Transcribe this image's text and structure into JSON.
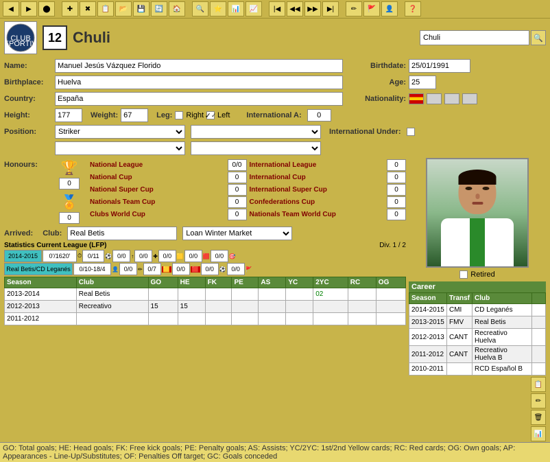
{
  "toolbar": {
    "buttons": [
      "◀",
      "▶",
      "●",
      "✚",
      "✖",
      "📋",
      "📂",
      "💾",
      "🔄",
      "🏠",
      "❓"
    ]
  },
  "header": {
    "player_number": "12",
    "player_name": "Chuli",
    "search_placeholder": "Chuli"
  },
  "basic_info": {
    "name_label": "Name:",
    "name_value": "Manuel Jesús Vázquez Florido",
    "birthplace_label": "Birthplace:",
    "birthplace_value": "Huelva",
    "country_label": "Country:",
    "country_value": "España",
    "height_label": "Height:",
    "height_value": "177",
    "weight_label": "Weight:",
    "weight_value": "67",
    "leg_label": "Leg:",
    "right_label": "Right",
    "left_label": "Left",
    "position_label": "Position:",
    "position_value": "Striker",
    "birthdate_label": "Birthdate:",
    "birthdate_value": "25/01/1991",
    "age_label": "Age:",
    "age_value": "25",
    "nationality_label": "Nationality:",
    "intl_a_label": "International A:",
    "intl_a_value": "0",
    "intl_under_label": "International Under:"
  },
  "honours": {
    "section_label": "Honours:",
    "left_col": [
      {
        "name": "National League",
        "value": "0/0"
      },
      {
        "name": "National Cup",
        "value": "0"
      },
      {
        "name": "National Super Cup",
        "value": "0"
      },
      {
        "name": "Nationals Team Cup",
        "value": "0"
      },
      {
        "name": "Clubs World Cup",
        "value": "0"
      }
    ],
    "right_col": [
      {
        "name": "International League",
        "value": "0"
      },
      {
        "name": "International Cup",
        "value": "0"
      },
      {
        "name": "International Super Cup",
        "value": "0"
      },
      {
        "name": "Confederations Cup",
        "value": "0"
      },
      {
        "name": "Nationals Team World Cup",
        "value": "0"
      }
    ]
  },
  "arrived": {
    "arrived_label": "Arrived:",
    "club_label": "Club:",
    "club_value": "Real Betis",
    "market_value": "Loan Winter Market"
  },
  "statistics": {
    "header": "Statistics Current League (LFP)",
    "div_label": "Div. 1 / 2",
    "row1": {
      "season": "2014-2015",
      "time": "0'/1620'",
      "col1": "0/11",
      "col2": "0/0",
      "col3": "0/0",
      "col4": "0/0",
      "col5": "0/0",
      "col6": "0/0"
    },
    "row2": {
      "team": "Real Betis/CD Leganés",
      "appearances": "0/10-18/4",
      "col1": "0/0",
      "col2": "0/7",
      "col3": "0/0",
      "col4": "0/0",
      "col5": "0/0"
    },
    "season_cols": [
      "Season",
      "Club",
      "GO",
      "HE",
      "FK",
      "PE",
      "AS",
      "YC",
      "2YC",
      "RC",
      "OG"
    ],
    "season_rows": [
      {
        "season": "2013-2014",
        "club": "Real Betis",
        "go": "",
        "he": "",
        "fk": "",
        "pe": "",
        "as": "",
        "yc": "",
        "2yc": "02",
        "rc": "",
        "og": ""
      },
      {
        "season": "2012-2013",
        "club": "Recreativo",
        "go": "15",
        "he": "15",
        "fk": "",
        "pe": "",
        "as": "",
        "yc": "",
        "2yc": "",
        "rc": "",
        "og": ""
      },
      {
        "season": "2011-2012",
        "club": "",
        "go": "",
        "he": "",
        "fk": "",
        "pe": "",
        "as": "",
        "yc": "",
        "2yc": "",
        "rc": "",
        "og": ""
      }
    ]
  },
  "career": {
    "header": "Career",
    "cols": [
      "Season",
      "Transf",
      "Club"
    ],
    "rows": [
      {
        "season": "2014-2015",
        "transf": "CMI",
        "club": "CD Leganés"
      },
      {
        "season": "2013-2015",
        "transf": "FMV",
        "club": "Real Betis"
      },
      {
        "season": "2012-2013",
        "transf": "CANT",
        "club": "Recreativo Huelva"
      },
      {
        "season": "2011-2012",
        "transf": "CANT",
        "club": "Recreativo Huelva B"
      },
      {
        "season": "2010-2011",
        "transf": "",
        "club": "RCD Español B"
      }
    ]
  },
  "retired_label": "Retired",
  "legend": "GO: Total goals; HE: Head goals; FK: Free kick goals; PE: Penalty goals; AS: Assists; YC/2YC: 1st/2nd Yellow cards; RC: Red cards; OG: Own goals; AP: Appearances - Line-Up/Substitutes; OF: Penalties Off target; GC: Goals conceded"
}
